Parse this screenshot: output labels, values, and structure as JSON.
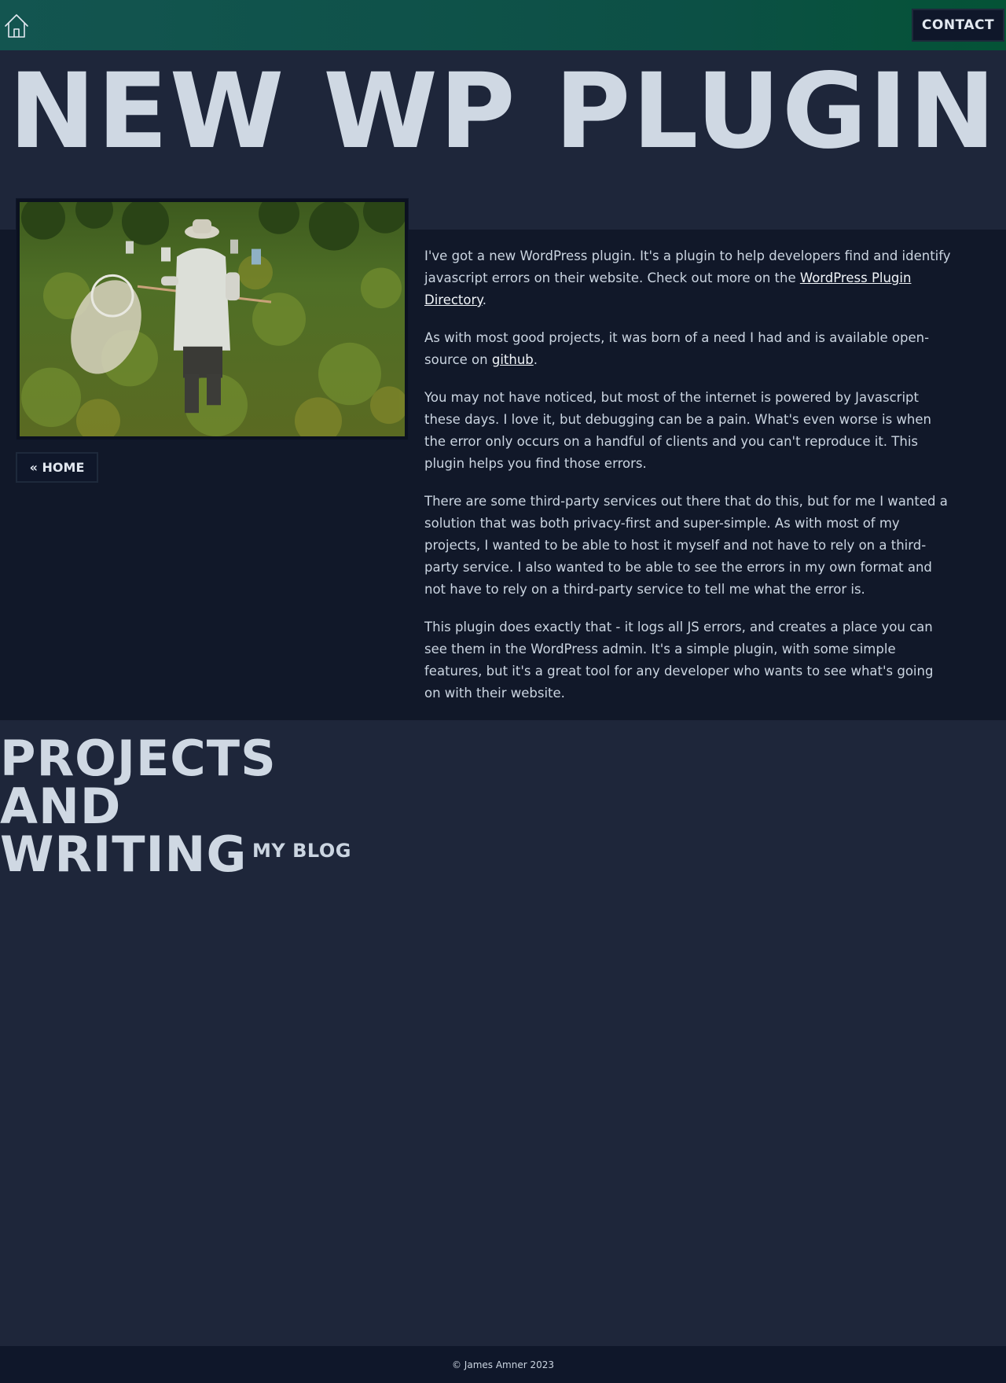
{
  "header": {
    "home_icon": "home-icon",
    "contact_label": "CONTACT"
  },
  "hero": {
    "title": "NEW WP PLUGIN"
  },
  "sidebar": {
    "home_link_label": "« HOME"
  },
  "article": {
    "p1_before": "I've got a new WordPress plugin. It's a plugin to help developers find and identify javascript errors on their website. Check out more on the ",
    "p1_link": "WordPress Plugin Directory",
    "p1_after": ".",
    "p2_before": "As with most good projects, it was born of a need I had and is available open-source on ",
    "p2_link": "github",
    "p2_after": ".",
    "p3": "You may not have noticed, but most of the internet is powered by Javascript these days. I love it, but debugging can be a pain. What's even worse is when the error only occurs on a handful of clients and you can't reproduce it. This plugin helps you find those errors.",
    "p4": "There are some third-party services out there that do this, but for me I wanted a solution that was both privacy-first and super-simple. As with most of my projects, I wanted to be able to host it myself and not have to rely on a third-party service. I also wanted to be able to see the errors in my own format and not have to rely on a third-party service to tell me what the error is.",
    "p5": "This plugin does exactly that - it logs all JS errors, and creates a place you can see them in the WordPress admin. It's a simple plugin, with some simple features, but it's a great tool for any developer who wants to see what's going on with their website."
  },
  "projects": {
    "title_line1": "PROJECTS",
    "title_line2": "AND",
    "title_line3": "WRITING",
    "blog_label": "MY BLOG"
  },
  "footer": {
    "copyright": "© James Amner 2023"
  },
  "colors": {
    "topbar_start": "#135550",
    "topbar_end": "#045336",
    "page_bg": "#1e263a",
    "content_bg": "#111829",
    "footer_bg": "#0f172a",
    "text": "#cbd5e1"
  }
}
